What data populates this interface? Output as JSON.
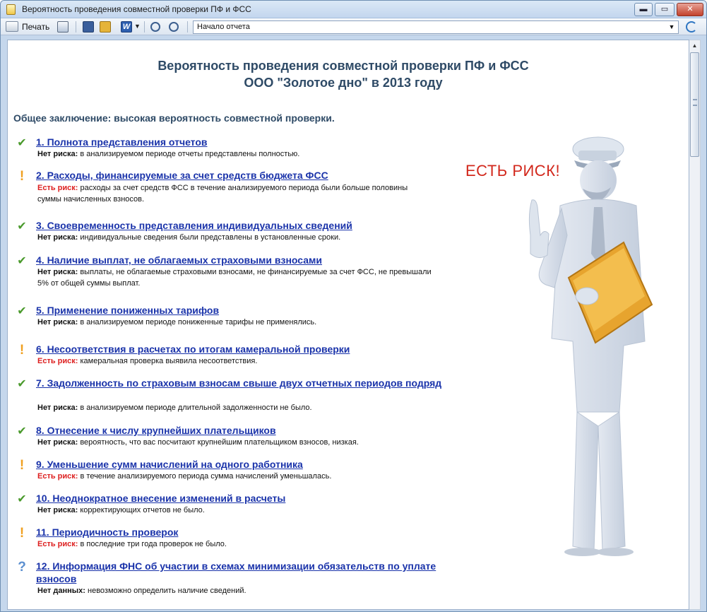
{
  "window": {
    "title": "Вероятность проведения совместной проверки ПФ и ФСС",
    "minimize_label": "▬",
    "maximize_label": "▭",
    "close_label": "✕"
  },
  "toolbar": {
    "print_label": "Печать",
    "section_select_value": "Начало отчета"
  },
  "report": {
    "title_line1": "Вероятность проведения совместной проверки ПФ и ФСС",
    "title_line2": "ООО \"Золотое дно\" в 2013 году",
    "conclusion": "Общее заключение: высокая вероятность совместной проверки.",
    "risk_callout": "ЕСТЬ РИСК!",
    "items": [
      {
        "status": "ok",
        "title": "1. Полнота представления отчетов",
        "label": "Нет риска",
        "text": "в анализируемом периоде отчеты представлены полностью."
      },
      {
        "status": "risk",
        "title": "2. Расходы, финансируемые за счет средств бюджета ФСС",
        "label": "Есть риск",
        "text": "расходы за счет средств ФСС в течение анализируемого периода были больше половины суммы начисленных взносов."
      },
      {
        "status": "ok",
        "title": "3. Своевременность представления индивидуальных сведений",
        "label": "Нет риска",
        "text": "индивидуальные сведения были представлены в установленные сроки."
      },
      {
        "status": "ok",
        "title": "4. Наличие выплат, не облагаемых страховыми взносами",
        "label": "Нет риска",
        "text": "выплаты, не облагаемые страховыми взносами, не финансируемые за счет ФСС, не превышали 5% от общей суммы выплат."
      },
      {
        "status": "ok",
        "title": "5. Применение пониженных тарифов",
        "label": "Нет риска",
        "text": "в анализируемом периоде пониженные тарифы не применялись."
      },
      {
        "status": "risk",
        "title": "6. Несоответствия в расчетах по итогам камеральной проверки",
        "label": "Есть риск",
        "text": "камеральная проверка выявила несоответствия."
      },
      {
        "status": "ok",
        "title": "7. Задолженность по страховым взносам свыше двух отчетных периодов подряд",
        "label": "Нет риска",
        "text": "в анализируемом периоде длительной задолженности не было."
      },
      {
        "status": "ok",
        "title": "8. Отнесение к числу крупнейших плательщиков",
        "label": "Нет риска",
        "text": "вероятность, что вас посчитают крупнейшим плательщиком взносов, низкая."
      },
      {
        "status": "risk",
        "title": "9. Уменьшение сумм начислений на одного работника",
        "label": "Есть риск",
        "text": "в течение анализируемого периода сумма начислений уменьшалась."
      },
      {
        "status": "ok",
        "title": "10. Неоднократное внесение изменений в расчеты",
        "label": "Нет риска",
        "text": "корректирующих отчетов не было."
      },
      {
        "status": "risk",
        "title": "11. Периодичность проверок",
        "label": "Есть риск",
        "text": "в последние три года проверок не было."
      },
      {
        "status": "unknown",
        "title": "12. Информация ФНС об участии в схемах минимизации обязательств по уплате взносов",
        "label": "Нет данных",
        "text": "невозможно определить наличие сведений."
      }
    ]
  }
}
